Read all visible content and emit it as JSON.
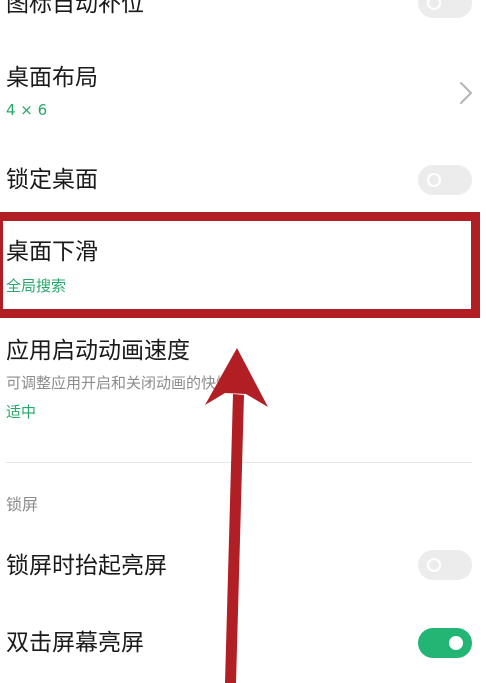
{
  "settings": {
    "icon_auto_fill": {
      "title": "图标自动补位"
    },
    "desktop_layout": {
      "title": "桌面布局",
      "value": "4 × 6"
    },
    "lock_desktop": {
      "title": "锁定桌面"
    },
    "desktop_swipe_down": {
      "title": "桌面下滑",
      "value": "全局搜索"
    },
    "app_launch_speed": {
      "title": "应用启动动画速度",
      "description": "可调整应用开启和关闭动画的快慢",
      "value": "适中"
    },
    "lock_screen_section": {
      "label": "锁屏"
    },
    "raise_to_wake": {
      "title": "锁屏时抬起亮屏"
    },
    "double_tap_wake": {
      "title": "双击屏幕亮屏"
    }
  },
  "toggle_states": {
    "icon_auto_fill": "off",
    "lock_desktop": "off",
    "raise_to_wake": "off",
    "double_tap_wake": "on"
  },
  "colors": {
    "accent": "#25a86a",
    "toggle_on": "#22b573",
    "toggle_off": "#ececec",
    "annotation_red": "#b11f24"
  },
  "icons": {
    "desktop_layout_chevron": "chevron-right-icon",
    "annotation_arrow": "arrow-up-icon"
  }
}
